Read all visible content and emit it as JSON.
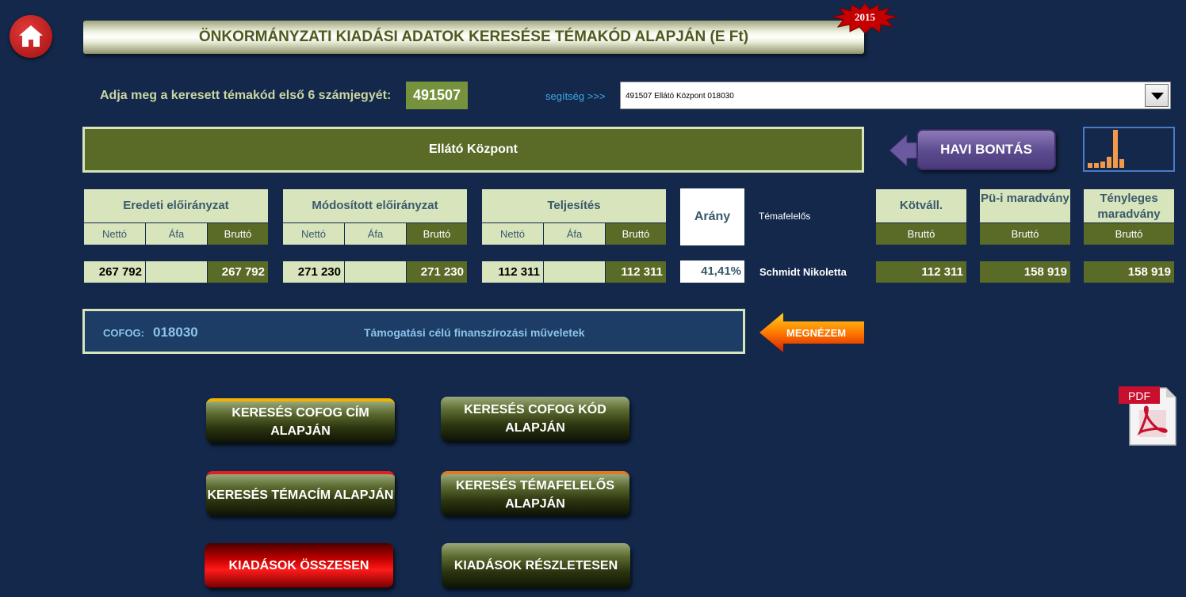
{
  "header": {
    "title": "ÖNKORMÁNYZATI KIADÁSI ADATOK KERESÉSE TÉMAKÓD ALAPJÁN (E Ft)",
    "year_badge": "2015"
  },
  "search": {
    "prompt": "Adja meg a keresett témakód első 6 számjegyét:",
    "code": "491507",
    "help_link": "segítség >>>",
    "dropdown_value": "491507 Ellátó Központ 018030"
  },
  "entity": {
    "name": "Ellátó Központ"
  },
  "havi": {
    "label": "HAVI BONTÁS"
  },
  "mini_chart": {
    "bars": [
      0.12,
      0.12,
      0.16,
      0.3,
      1.0,
      0.22
    ]
  },
  "groups": [
    {
      "title": "Eredeti előirányzat",
      "netto": "Nettó",
      "afa": "Áfa",
      "brutto": "Bruttó",
      "netto_val": "267 792",
      "afa_val": "",
      "brutto_val": "267 792"
    },
    {
      "title": "Módosított előirányzat",
      "netto": "Nettó",
      "afa": "Áfa",
      "brutto": "Bruttó",
      "netto_val": "271 230",
      "afa_val": "",
      "brutto_val": "271 230"
    },
    {
      "title": "Teljesítés",
      "netto": "Nettó",
      "afa": "Áfa",
      "brutto": "Bruttó",
      "netto_val": "112 311",
      "afa_val": "",
      "brutto_val": "112 311"
    }
  ],
  "arany": {
    "label": "Arány",
    "value": "41,41%"
  },
  "temafelelos": {
    "label": "Témafelelős",
    "value": "Schmidt Nikoletta"
  },
  "extra": [
    {
      "title": "Kötváll.",
      "sub": "Bruttó",
      "value": "112 311"
    },
    {
      "title": "Pü-i maradvány",
      "sub": "Bruttó",
      "value": "158 919"
    },
    {
      "title": "Tényleges maradvány",
      "sub": "Bruttó",
      "value": "158 919"
    }
  ],
  "cofog": {
    "label": "COFOG:",
    "code": "018030",
    "text": "Támogatási célú finanszírozási műveletek"
  },
  "megnezem": {
    "label": "MEGNÉZEM"
  },
  "buttons": {
    "cofog_cim": "KERESÉS COFOG CÍM ALAPJÁN",
    "cofog_kod": "KERESÉS COFOG KÓD ALAPJÁN",
    "temacim": "KERESÉS TÉMACÍM ALAPJÁN",
    "temafelelos": "KERESÉS TÉMAFELELŐS ALAPJÁN",
    "osszesen": "KIADÁSOK ÖSSZESEN",
    "reszletesen": "KIADÁSOK RÉSZLETESEN"
  },
  "pdf": {
    "label": "PDF"
  },
  "colors": {
    "background": "#13284a",
    "olive": "#5a6b27",
    "light_green": "#d8e4bc",
    "accent_blue": "#3fa9e8",
    "red": "#c00000"
  }
}
